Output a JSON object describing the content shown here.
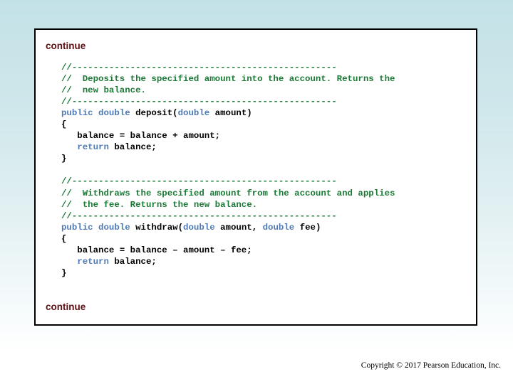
{
  "slide": {
    "continue_top_label": "continue",
    "continue_bottom_label": "continue",
    "copyright": "Copyright © 2017 Pearson Education, Inc.",
    "colors": {
      "background_top": "#c3e2e7",
      "background_bottom": "#ffffff",
      "box_background": "#ffffff",
      "box_border": "#000000",
      "continue_text": "#5c1014",
      "comment": "#1a7a35",
      "keyword": "#4e7ab5",
      "plain_code": "#000000"
    }
  },
  "code": {
    "lines": [
      {
        "id": "l01",
        "segments": [
          {
            "cls": "cmt",
            "text": "//--------------------------------------------------"
          }
        ]
      },
      {
        "id": "l02",
        "segments": [
          {
            "cls": "cmt",
            "text": "//  Deposits the specified amount into the account. Returns the"
          }
        ]
      },
      {
        "id": "l03",
        "segments": [
          {
            "cls": "cmt",
            "text": "//  new balance."
          }
        ]
      },
      {
        "id": "l04",
        "segments": [
          {
            "cls": "cmt",
            "text": "//--------------------------------------------------"
          }
        ]
      },
      {
        "id": "l05",
        "segments": [
          {
            "cls": "kw",
            "text": "public double "
          },
          {
            "cls": "pl",
            "text": "deposit("
          },
          {
            "cls": "kw",
            "text": "double "
          },
          {
            "cls": "pl",
            "text": "amount)"
          }
        ]
      },
      {
        "id": "l06",
        "segments": [
          {
            "cls": "pl",
            "text": "{"
          }
        ]
      },
      {
        "id": "l07",
        "segments": [
          {
            "cls": "pl",
            "text": "   balance = balance + amount;"
          }
        ]
      },
      {
        "id": "l08",
        "segments": [
          {
            "cls": "kw",
            "text": "   return "
          },
          {
            "cls": "pl",
            "text": "balance;"
          }
        ]
      },
      {
        "id": "l09",
        "segments": [
          {
            "cls": "pl",
            "text": "}"
          }
        ]
      },
      {
        "id": "l10",
        "segments": [
          {
            "cls": "pl",
            "text": ""
          }
        ]
      },
      {
        "id": "l11",
        "segments": [
          {
            "cls": "cmt",
            "text": "//--------------------------------------------------"
          }
        ]
      },
      {
        "id": "l12",
        "segments": [
          {
            "cls": "cmt",
            "text": "//  Withdraws the specified amount from the account and applies"
          }
        ]
      },
      {
        "id": "l13",
        "segments": [
          {
            "cls": "cmt",
            "text": "//  the fee. Returns the new balance."
          }
        ]
      },
      {
        "id": "l14",
        "segments": [
          {
            "cls": "cmt",
            "text": "//--------------------------------------------------"
          }
        ]
      },
      {
        "id": "l15",
        "segments": [
          {
            "cls": "kw",
            "text": "public double "
          },
          {
            "cls": "pl",
            "text": "withdraw("
          },
          {
            "cls": "kw",
            "text": "double "
          },
          {
            "cls": "pl",
            "text": "amount, "
          },
          {
            "cls": "kw",
            "text": "double "
          },
          {
            "cls": "pl",
            "text": "fee)"
          }
        ]
      },
      {
        "id": "l16",
        "segments": [
          {
            "cls": "pl",
            "text": "{"
          }
        ]
      },
      {
        "id": "l17",
        "segments": [
          {
            "cls": "pl",
            "text": "   balance = balance – amount – fee;"
          }
        ]
      },
      {
        "id": "l18",
        "segments": [
          {
            "cls": "kw",
            "text": "   return "
          },
          {
            "cls": "pl",
            "text": "balance;"
          }
        ]
      },
      {
        "id": "l19",
        "segments": [
          {
            "cls": "pl",
            "text": "}"
          }
        ]
      }
    ]
  }
}
